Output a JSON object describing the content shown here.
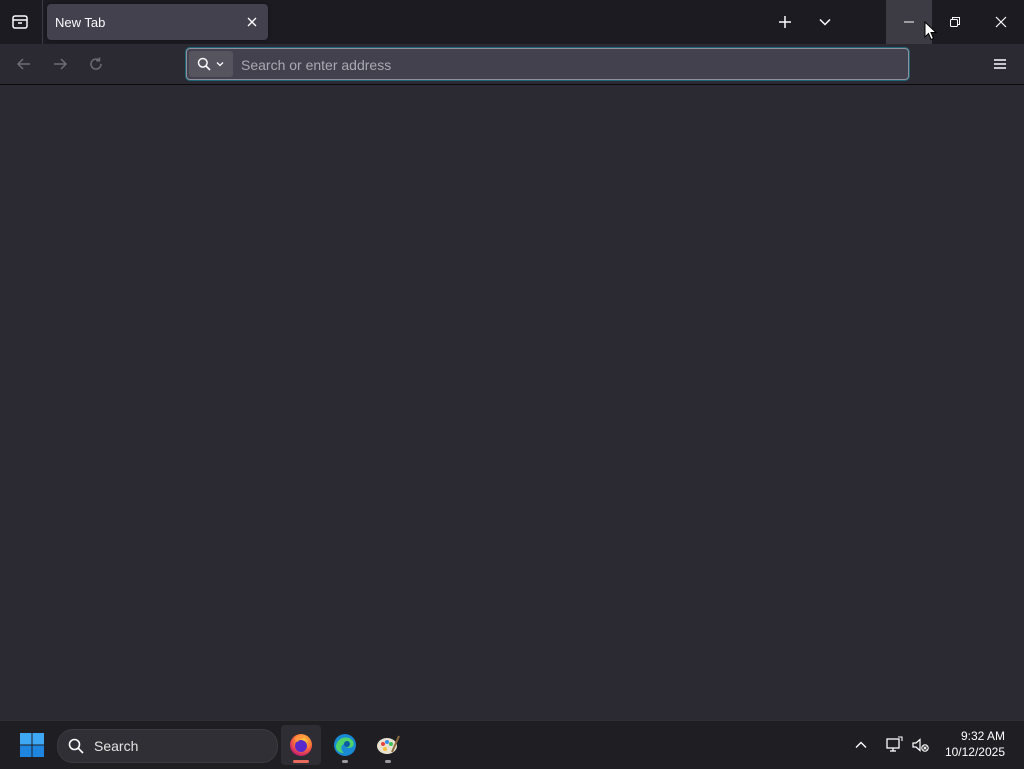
{
  "browser": {
    "active_tab": {
      "title": "New Tab"
    },
    "urlbar": {
      "placeholder": "Search or enter address",
      "value": ""
    }
  },
  "taskbar": {
    "search_label": "Search",
    "clock": {
      "time": "9:32 AM",
      "date": "10/12/2025"
    },
    "apps": [
      {
        "name": "firefox",
        "active": true,
        "indicator_color": "#e86a5d"
      },
      {
        "name": "edge",
        "active": false
      },
      {
        "name": "paint",
        "active": false
      }
    ]
  },
  "colors": {
    "accent": "#00ddff",
    "titlebar": "#1c1b22",
    "toolbar": "#2b2a33",
    "tab_active": "#42414d"
  }
}
